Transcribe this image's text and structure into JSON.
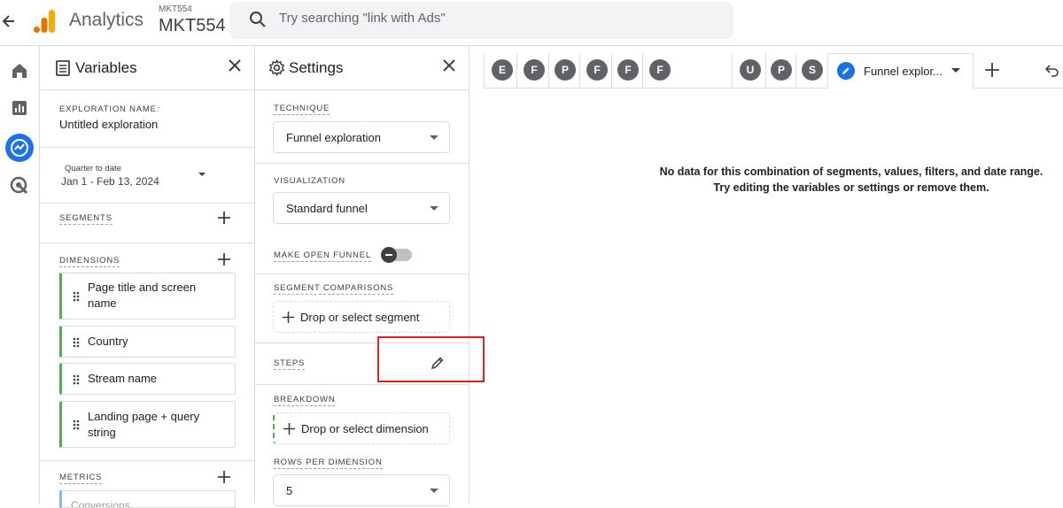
{
  "header": {
    "app_title": "Analytics",
    "account_small": "MKT554",
    "account_big": "MKT554",
    "search_placeholder": "Try searching \"link with Ads\""
  },
  "nav": {
    "items": [
      "home-icon",
      "reports-icon",
      "explore-icon",
      "advertising-icon"
    ],
    "active_color": "#1a73e8"
  },
  "variables": {
    "title": "Variables",
    "exploration_name_label": "EXPLORATION NAME:",
    "exploration_name": "Untitled exploration",
    "date_preset": "Quarter to date",
    "date_range": "Jan 1 - Feb 13, 2024",
    "segments_label": "SEGMENTS",
    "dimensions_label": "DIMENSIONS",
    "dimensions": [
      {
        "line1": "Page title and screen",
        "line2": "name"
      },
      {
        "line1": "Country",
        "line2": ""
      },
      {
        "line1": "Stream name",
        "line2": ""
      },
      {
        "line1": "Landing page + query",
        "line2": "string"
      }
    ],
    "metrics_label": "METRICS",
    "metrics": [
      "Conversions"
    ]
  },
  "settings": {
    "title": "Settings",
    "technique_label": "TECHNIQUE",
    "technique_value": "Funnel exploration",
    "visualization_label": "VISUALIZATION",
    "visualization_value": "Standard funnel",
    "open_funnel_label": "MAKE OPEN FUNNEL",
    "segment_comparisons_label": "SEGMENT COMPARISONS",
    "segment_drop": "Drop or select segment",
    "steps_label": "STEPS",
    "breakdown_label": "BREAKDOWN",
    "breakdown_drop": "Drop or select dimension",
    "rows_label": "ROWS PER DIMENSION",
    "rows_value": "5"
  },
  "canvas": {
    "tabs": [
      "E",
      "F",
      "P",
      "F",
      "F",
      "F",
      "U",
      "P",
      "S"
    ],
    "active_tab": "Funnel explor...",
    "no_data_line1": "No data for this combination of segments, values, filters, and date range.",
    "no_data_line2": "Try editing the variables or settings or remove them."
  },
  "colors": {
    "accent": "#1a73e8",
    "dimension_bar": "#4caf50",
    "highlight": "#e02020"
  }
}
